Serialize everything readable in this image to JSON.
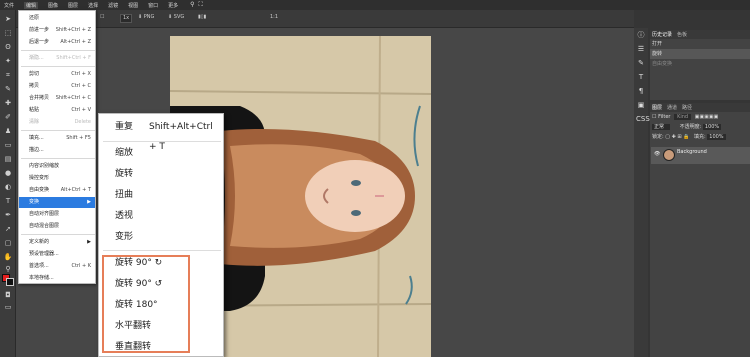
{
  "menubar": {
    "items": [
      "文件",
      "编辑",
      "图像",
      "图层",
      "选择",
      "滤镜",
      "视图",
      "窗口",
      "更多"
    ]
  },
  "optionsbar": {
    "zoom_label": "1x",
    "png_label": "PNG",
    "svg_label": "SVG",
    "extra": "1:1"
  },
  "edit_menu": {
    "items": [
      {
        "label": "还原",
        "shortcut": "",
        "disabled": false
      },
      {
        "label": "前进一步",
        "shortcut": "Shift+Ctrl + Z",
        "disabled": false
      },
      {
        "label": "后退一步",
        "shortcut": "Alt+Ctrl + Z",
        "disabled": false
      },
      {
        "label": "渐隐...",
        "shortcut": "Shift+Ctrl + F",
        "disabled": true
      },
      {
        "label": "剪切",
        "shortcut": "Ctrl + X",
        "disabled": false
      },
      {
        "label": "拷贝",
        "shortcut": "Ctrl + C",
        "disabled": false
      },
      {
        "label": "合并拷贝",
        "shortcut": "Shift+Ctrl + C",
        "disabled": false
      },
      {
        "label": "粘贴",
        "shortcut": "Ctrl + V",
        "disabled": false
      },
      {
        "label": "清除",
        "shortcut": "Delete",
        "disabled": true
      },
      {
        "label": "填充...",
        "shortcut": "Shift + F5",
        "disabled": false
      },
      {
        "label": "描边...",
        "shortcut": "",
        "disabled": false
      },
      {
        "label": "内容识别缩放",
        "shortcut": "",
        "disabled": false
      },
      {
        "label": "操控变形",
        "shortcut": "",
        "disabled": false
      },
      {
        "label": "自由变换",
        "shortcut": "Alt+Ctrl + T",
        "disabled": false
      },
      {
        "label": "变换",
        "shortcut": "",
        "disabled": false
      },
      {
        "label": "自动对齐图层",
        "shortcut": "",
        "disabled": false
      },
      {
        "label": "自动混合图层",
        "shortcut": "",
        "disabled": false
      },
      {
        "label": "定义新的",
        "shortcut": "",
        "disabled": false
      },
      {
        "label": "预设管理器...",
        "shortcut": "",
        "disabled": false
      },
      {
        "label": "首选项...",
        "shortcut": "Ctrl + K",
        "disabled": false
      },
      {
        "label": "本地存储...",
        "shortcut": "",
        "disabled": false
      }
    ]
  },
  "transform_submenu": {
    "items": [
      {
        "label": "重复",
        "shortcut": "Shift+Alt+Ctrl + T"
      },
      {
        "label": "缩放"
      },
      {
        "label": "旋转"
      },
      {
        "label": "扭曲"
      },
      {
        "label": "透视"
      },
      {
        "label": "变形"
      },
      {
        "label": "旋转 90° ↻"
      },
      {
        "label": "旋转 90° ↺"
      },
      {
        "label": "旋转 180°"
      },
      {
        "label": "水平翻转"
      },
      {
        "label": "垂直翻转"
      }
    ]
  },
  "history_panel": {
    "tabs": [
      "历史记录",
      "色板"
    ],
    "rows": [
      "打开",
      "旋转",
      "自由变换"
    ]
  },
  "layers_panel": {
    "tabs": [
      "图层",
      "通道",
      "路径"
    ],
    "filter_label": "Filter",
    "kind_label": "Kind",
    "blend_mode": "正常",
    "opacity_label": "不透明度:",
    "opacity_value": "100%",
    "lock_label": "锁定:",
    "fill_label": "填充:",
    "fill_value": "100%",
    "layer_name": "Background"
  },
  "colors": {
    "foreground": "#e21f1f",
    "background": "#111111",
    "highlight_box": "#e67e58",
    "menu_highlight": "#2b7be0"
  }
}
